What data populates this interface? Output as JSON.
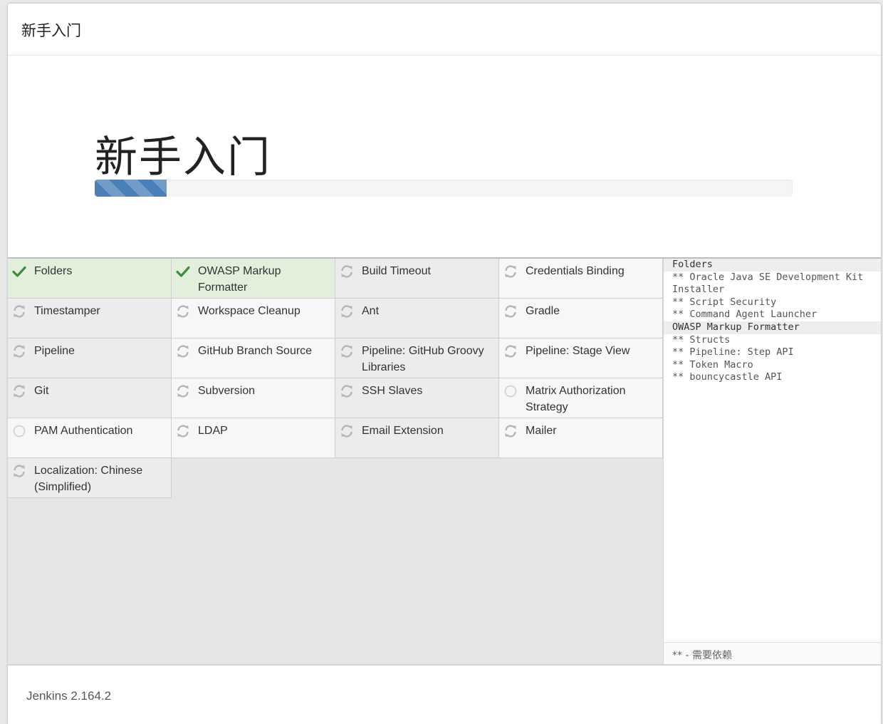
{
  "header": {
    "title": "新手入门"
  },
  "hero": {
    "title": "新手入门",
    "progress": 0.103
  },
  "colors": {
    "success_bg": "#e1efdb",
    "check": "#3d8b3d",
    "progress": "#4a7fb8"
  },
  "plugins": [
    {
      "label": "Folders",
      "status": "success"
    },
    {
      "label": "OWASP Markup Formatter",
      "status": "success"
    },
    {
      "label": "Build Timeout",
      "status": "installing"
    },
    {
      "label": "Credentials Binding",
      "status": "pending"
    },
    {
      "label": "Timestamper",
      "status": "installing"
    },
    {
      "label": "Workspace Cleanup",
      "status": "pending"
    },
    {
      "label": "Ant",
      "status": "installing"
    },
    {
      "label": "Gradle",
      "status": "pending"
    },
    {
      "label": "Pipeline",
      "status": "installing"
    },
    {
      "label": "GitHub Branch Source",
      "status": "pending"
    },
    {
      "label": "Pipeline: GitHub Groovy Libraries",
      "status": "installing"
    },
    {
      "label": "Pipeline: Stage View",
      "status": "pending"
    },
    {
      "label": "Git",
      "status": "installing"
    },
    {
      "label": "Subversion",
      "status": "pending"
    },
    {
      "label": "SSH Slaves",
      "status": "installing"
    },
    {
      "label": "Matrix Authorization Strategy",
      "status": "waiting"
    },
    {
      "label": "PAM Authentication",
      "status": "waiting"
    },
    {
      "label": "LDAP",
      "status": "pending"
    },
    {
      "label": "Email Extension",
      "status": "installing"
    },
    {
      "label": "Mailer",
      "status": "pending"
    },
    {
      "label": "Localization: Chinese (Simplified)",
      "status": "installing"
    }
  ],
  "log": [
    {
      "text": "Folders",
      "head": true
    },
    {
      "text": "** Oracle Java SE Development Kit Installer",
      "head": false
    },
    {
      "text": "** Script Security",
      "head": false
    },
    {
      "text": "** Command Agent Launcher",
      "head": false
    },
    {
      "text": "OWASP Markup Formatter",
      "head": true
    },
    {
      "text": "** Structs",
      "head": false
    },
    {
      "text": "** Pipeline: Step API",
      "head": false
    },
    {
      "text": "** Token Macro",
      "head": false
    },
    {
      "text": "** bouncycastle API",
      "head": false
    }
  ],
  "legend": {
    "text": "** - 需要依赖"
  },
  "footer": {
    "version": "Jenkins 2.164.2"
  }
}
